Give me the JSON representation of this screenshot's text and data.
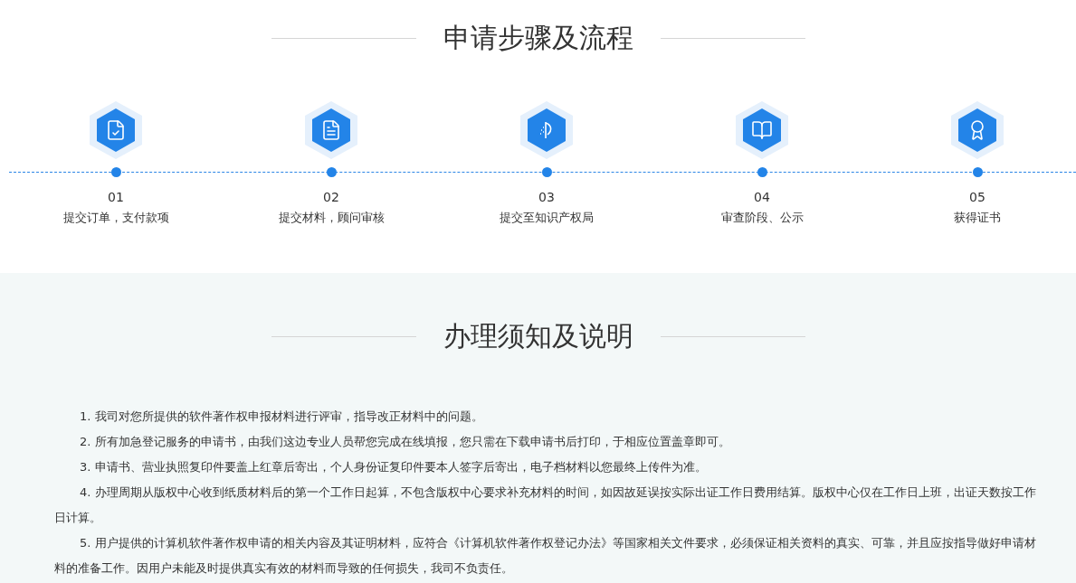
{
  "process": {
    "title": "申请步骤及流程",
    "steps": [
      {
        "number": "01",
        "label": "提交订单，支付款项"
      },
      {
        "number": "02",
        "label": "提交材料，顾问审核"
      },
      {
        "number": "03",
        "label": "提交至知识产权局"
      },
      {
        "number": "04",
        "label": "审查阶段、公示"
      },
      {
        "number": "05",
        "label": "获得证书"
      }
    ]
  },
  "notes": {
    "title": "办理须知及说明",
    "paragraphs": [
      "1. 我司对您所提供的软件著作权申报材料进行评审，指导改正材料中的问题。",
      "2. 所有加急登记服务的申请书，由我们这边专业人员帮您完成在线填报，您只需在下载申请书后打印，于相应位置盖章即可。",
      "3. 申请书、营业执照复印件要盖上红章后寄出，个人身份证复印件要本人签字后寄出，电子档材料以您最终上传件为准。",
      "4. 办理周期从版权中心收到纸质材料后的第一个工作日起算，不包含版权中心要求补充材料的时间，如因故延误按实际出证工作日费用结算。版权中心仅在工作日上班，出证天数按工作日计算。",
      "5. 用户提供的计算机软件著作权申请的相关内容及其证明材料，应符合《计算机软件著作权登记办法》等国家相关文件要求，必须保证相关资料的真实、可靠，并且应按指导做好申请材料的准备工作。因用户未能及时提供真实有效的材料而导致的任何损失，我司不负责任。"
    ]
  }
}
